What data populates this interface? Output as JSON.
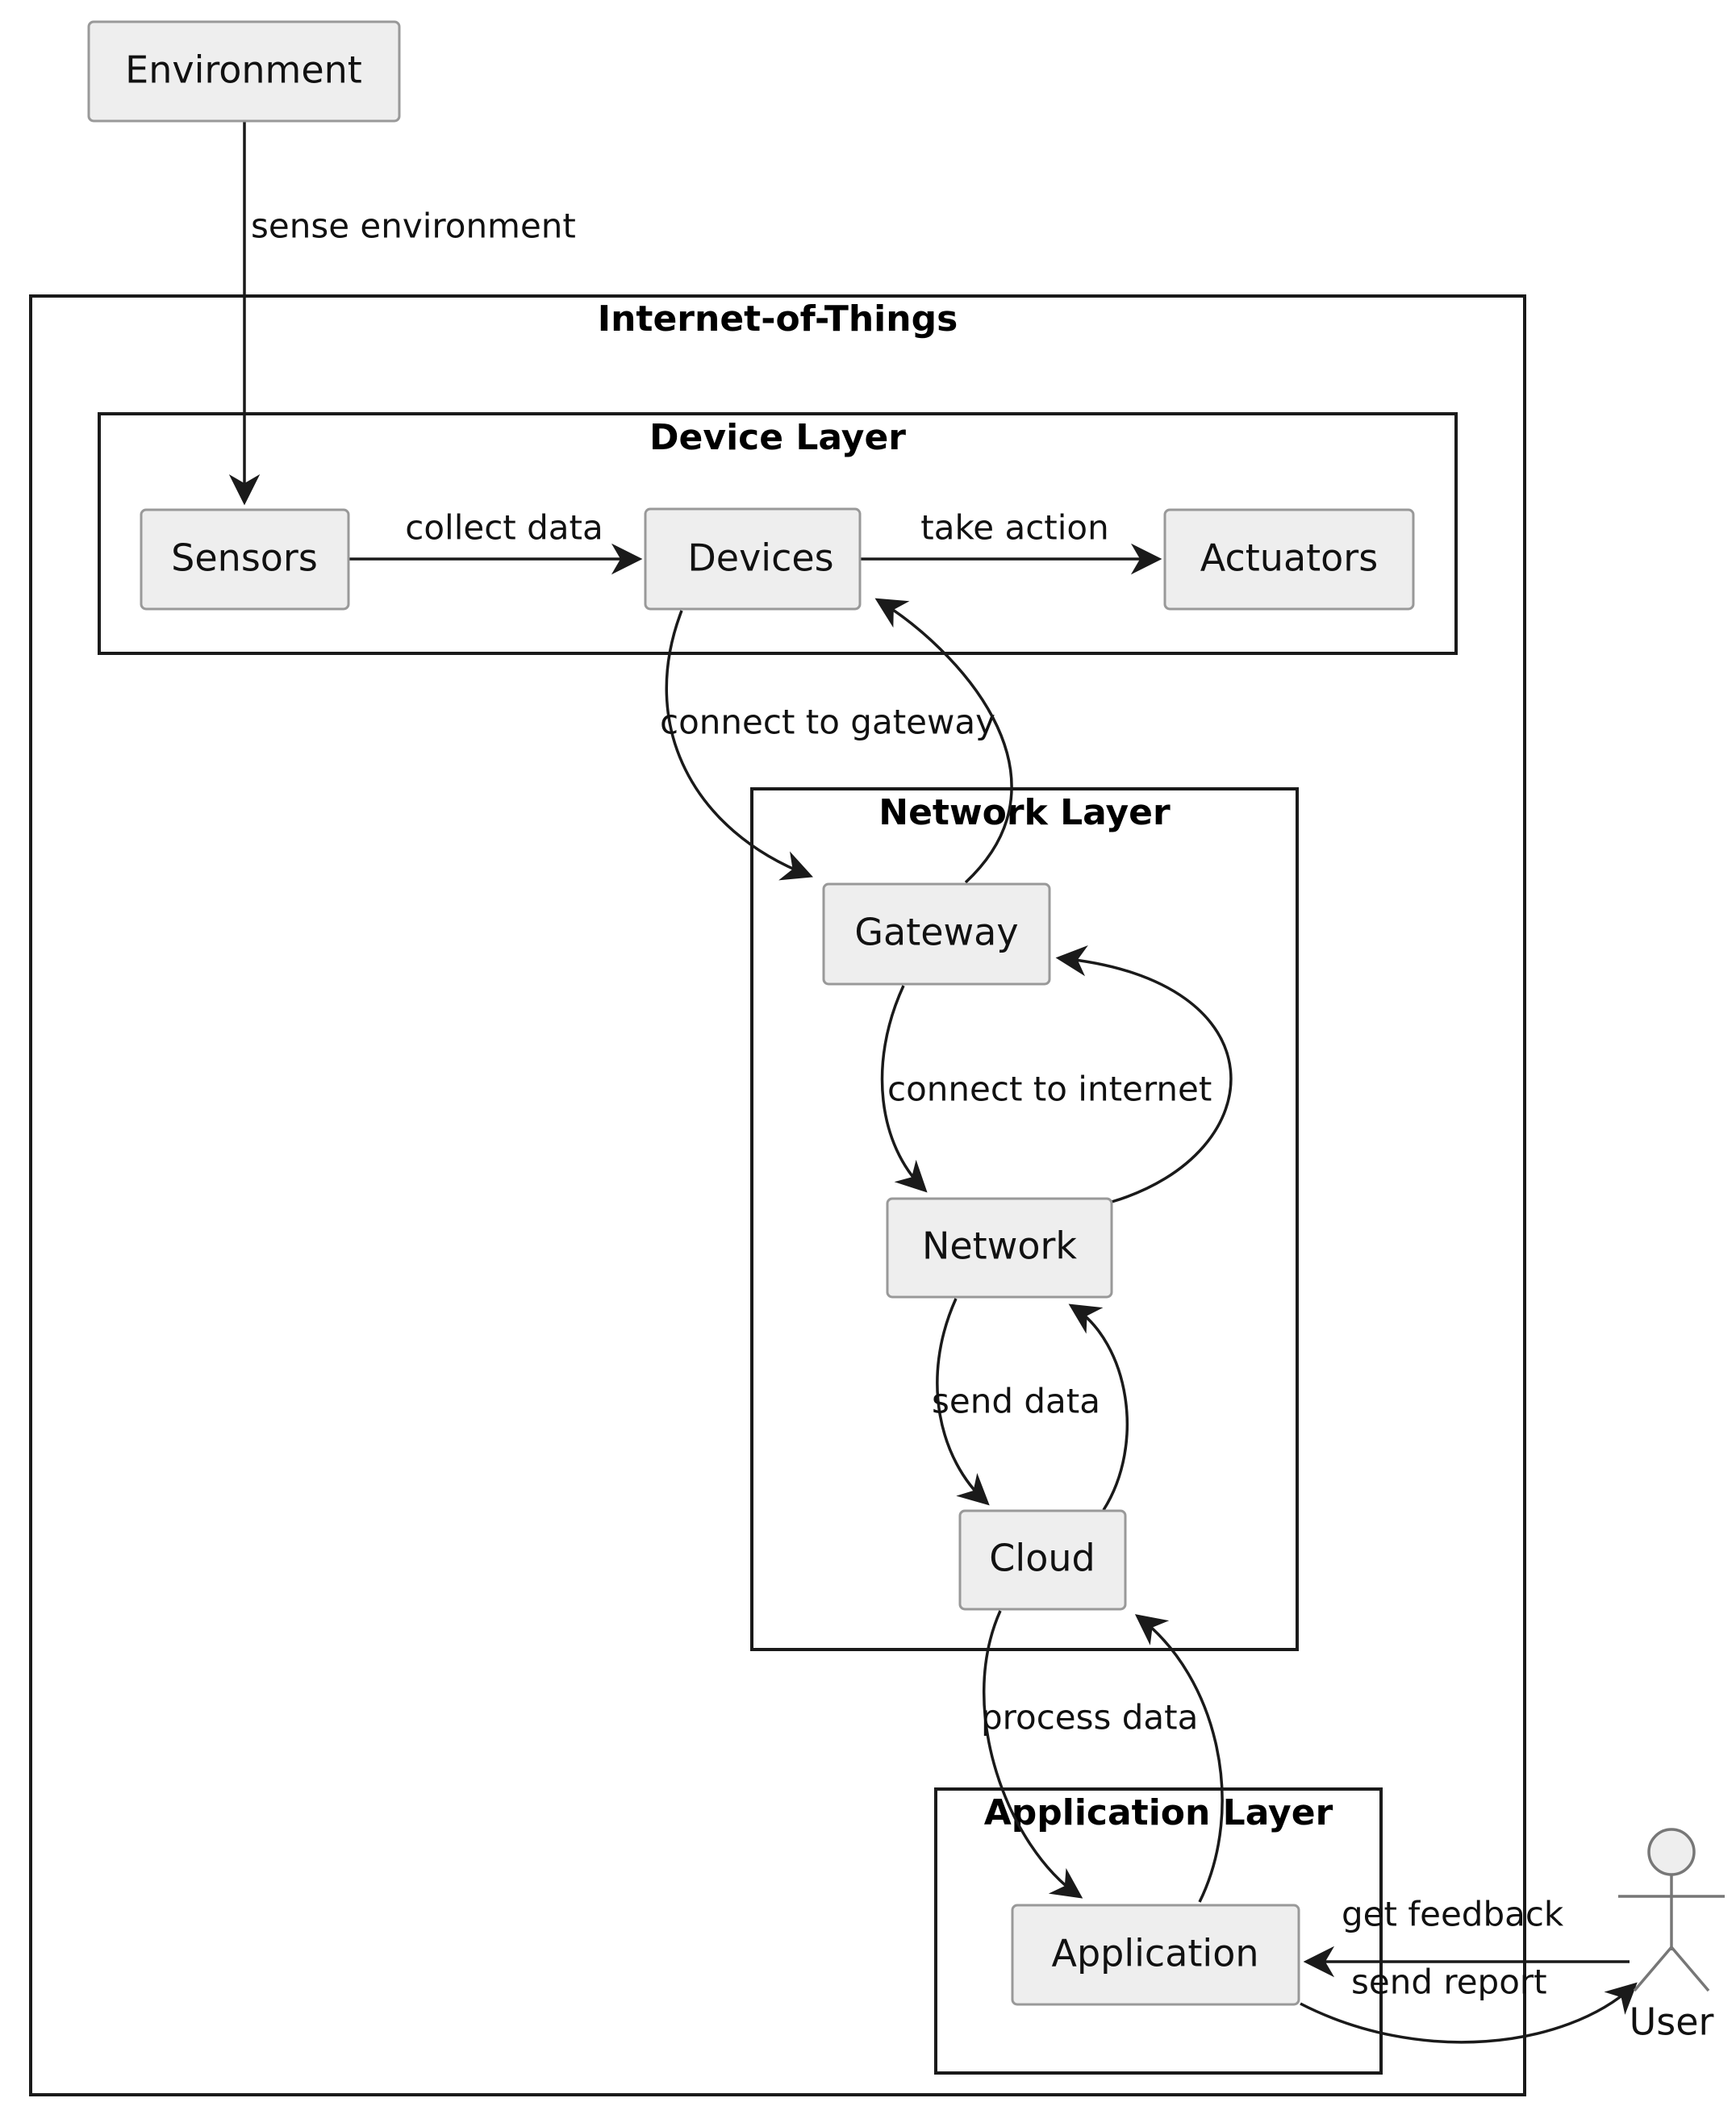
{
  "diagram": {
    "title": "Internet-of-Things",
    "external_nodes": [
      {
        "id": "environment",
        "label": "Environment"
      }
    ],
    "actors": [
      {
        "id": "user",
        "label": "User"
      }
    ],
    "containers": [
      {
        "id": "iot",
        "label": "Internet-of-Things",
        "nodes": [],
        "containers": [
          {
            "id": "device-layer",
            "label": "Device Layer",
            "nodes": [
              {
                "id": "sensors",
                "label": "Sensors"
              },
              {
                "id": "devices",
                "label": "Devices"
              },
              {
                "id": "actuators",
                "label": "Actuators"
              }
            ]
          },
          {
            "id": "network-layer",
            "label": "Network Layer",
            "nodes": [
              {
                "id": "gateway",
                "label": "Gateway"
              },
              {
                "id": "network",
                "label": "Network"
              },
              {
                "id": "cloud",
                "label": "Cloud"
              }
            ]
          },
          {
            "id": "application-layer",
            "label": "Application Layer",
            "nodes": [
              {
                "id": "application",
                "label": "Application"
              }
            ]
          }
        ]
      }
    ],
    "edges": [
      {
        "id": "e1",
        "from": "environment",
        "to": "sensors",
        "label": "sense environment"
      },
      {
        "id": "e2",
        "from": "sensors",
        "to": "devices",
        "label": "collect data"
      },
      {
        "id": "e3",
        "from": "devices",
        "to": "actuators",
        "label": "take action"
      },
      {
        "id": "e4",
        "from": "devices",
        "to": "gateway",
        "label": "connect to gateway"
      },
      {
        "id": "e5",
        "from": "gateway",
        "to": "devices",
        "label": ""
      },
      {
        "id": "e6",
        "from": "gateway",
        "to": "network",
        "label": "connect to internet"
      },
      {
        "id": "e7",
        "from": "network",
        "to": "gateway",
        "label": ""
      },
      {
        "id": "e8",
        "from": "network",
        "to": "cloud",
        "label": "send data"
      },
      {
        "id": "e9",
        "from": "cloud",
        "to": "network",
        "label": ""
      },
      {
        "id": "e10",
        "from": "cloud",
        "to": "application",
        "label": "process data"
      },
      {
        "id": "e11",
        "from": "application",
        "to": "cloud",
        "label": ""
      },
      {
        "id": "e12",
        "from": "user",
        "to": "application",
        "label": "get feedback"
      },
      {
        "id": "e13",
        "from": "application",
        "to": "user",
        "label": "send report"
      }
    ],
    "colors": {
      "node_fill": "#eeeeee",
      "node_stroke": "#999999",
      "container_stroke": "#1a1a1a",
      "edge_stroke": "#1a1a1a",
      "text": "#111111",
      "background": "#ffffff"
    }
  }
}
